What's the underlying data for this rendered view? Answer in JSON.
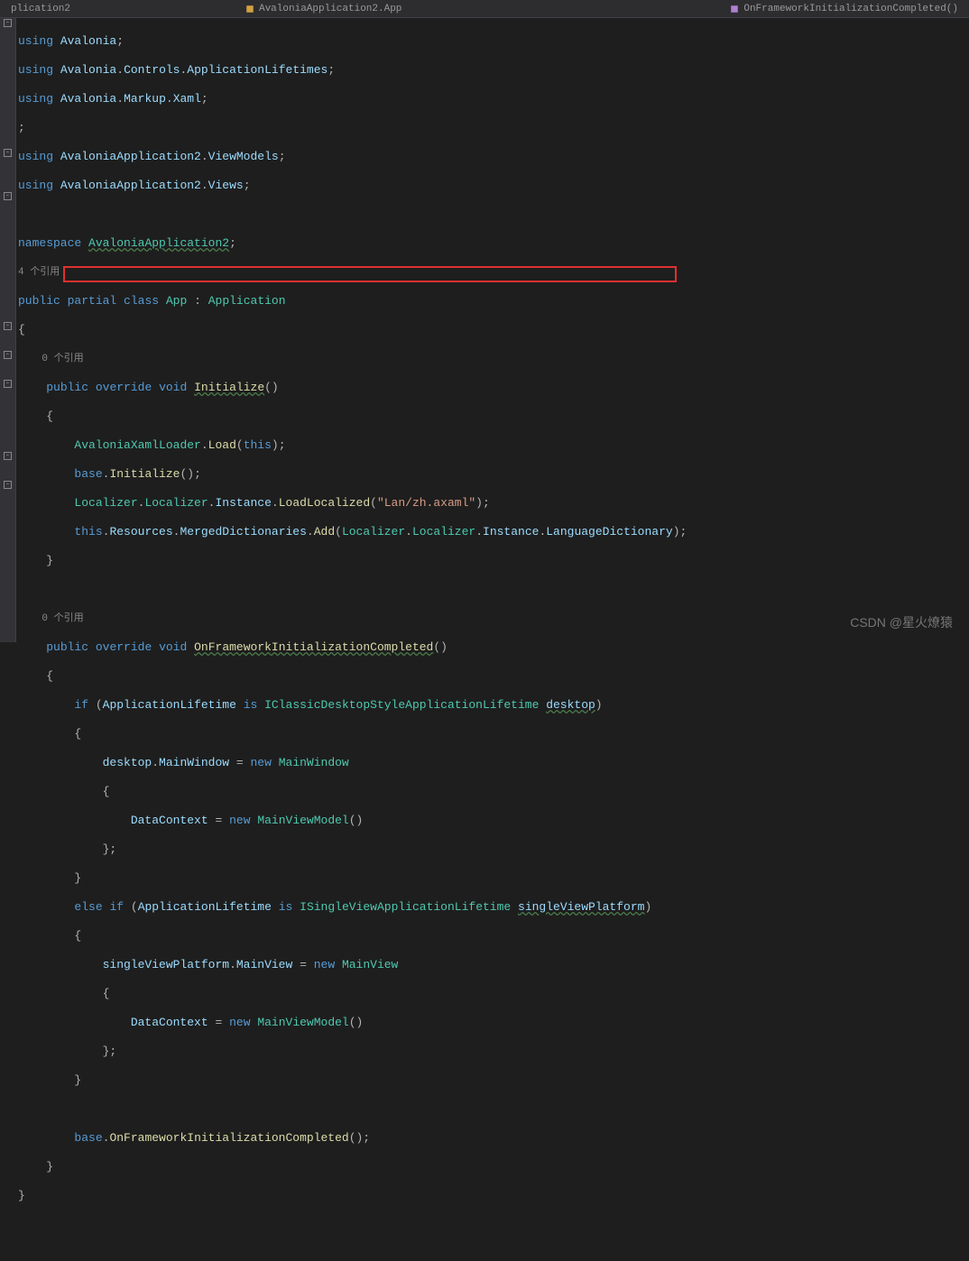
{
  "topbar": {
    "tabs": [
      {
        "label": "plication2"
      },
      {
        "label": "AvaloniaApplication2.App"
      },
      {
        "label": "OnFrameworkInitializationCompleted()"
      }
    ]
  },
  "codelens": {
    "refs_4": "4 个引用",
    "refs_0a": "0 个引用",
    "refs_0b": "0 个引用"
  },
  "code": {
    "using": "using",
    "avalonia": "Avalonia",
    "controls": "Controls",
    "applifetimes": "ApplicationLifetimes",
    "markup": "Markup",
    "xaml": "Xaml",
    "avaloniaApp2": "AvaloniaApplication2",
    "viewModels": "ViewModels",
    "views": "Views",
    "namespace": "namespace",
    "nsName": "AvaloniaApplication2",
    "public": "public",
    "partial": "partial",
    "class": "class",
    "app": "App",
    "application": "Application",
    "override": "override",
    "void": "void",
    "initialize": "Initialize",
    "avaloniaXamlLoader": "AvaloniaXamlLoader",
    "load": "Load",
    "this": "this",
    "base": "base",
    "localizer": "Localizer",
    "instance": "Instance",
    "loadLocalized": "LoadLocalized",
    "lanPath": "\"Lan/zh.axaml\"",
    "resources": "Resources",
    "mergedDictionaries": "MergedDictionaries",
    "add": "Add",
    "languageDictionary": "LanguageDictionary",
    "onFrameworkInit": "OnFrameworkInitializationCompleted",
    "if": "if",
    "applicationLifetime": "ApplicationLifetime",
    "is": "is",
    "iclassic": "IClassicDesktopStyleApplicationLifetime",
    "desktop": "desktop",
    "mainWindow": "MainWindow",
    "new": "new",
    "dataContext": "DataContext",
    "mainViewModel": "MainViewModel",
    "else": "else",
    "isingleView": "ISingleViewApplicationLifetime",
    "singleViewPlatform": "singleViewPlatform",
    "mainView": "MainView",
    "onFrameworkCall": "OnFrameworkInitializationCompleted"
  },
  "watermark": "CSDN @星火燎猿"
}
